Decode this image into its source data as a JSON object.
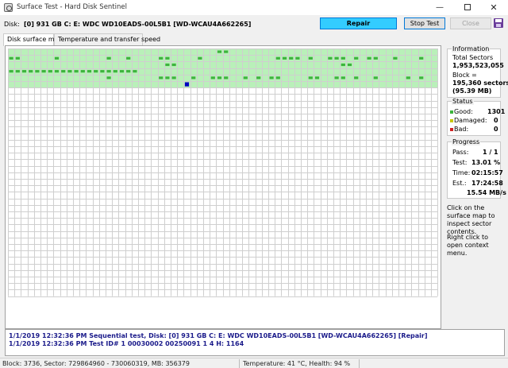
{
  "window": {
    "title": "Surface Test - Hard Disk Sentinel",
    "controls": {
      "minimize": "—",
      "close": "✕"
    }
  },
  "disk": {
    "label": "Disk:",
    "value": "[0] 931 GB C: E: WDC WD10EADS-00L5B1 [WD-WCAU4A662265]"
  },
  "buttons": {
    "repair": "Repair",
    "stop_test": "Stop Test",
    "close": "Close",
    "save_icon": "save-icon"
  },
  "tabs": [
    {
      "label": "Disk surface map",
      "active": true
    },
    {
      "label": "Temperature and transfer speed",
      "active": false
    }
  ],
  "colors": {
    "processed": "#b9f0b9",
    "good_marker": "#3cb43c",
    "current_block": "#0000c0",
    "grid_line": "#cfcfcf",
    "repair_button": "#33ccff"
  },
  "surface_map": {
    "columns": 66,
    "rows": 38,
    "processed_rows": 6,
    "current_block": {
      "row": 5,
      "col": 27
    },
    "good_markers": [
      {
        "row": 0,
        "col": 32
      },
      {
        "row": 0,
        "col": 33
      },
      {
        "row": 1,
        "col": 0
      },
      {
        "row": 1,
        "col": 1
      },
      {
        "row": 1,
        "col": 7
      },
      {
        "row": 1,
        "col": 15
      },
      {
        "row": 1,
        "col": 18
      },
      {
        "row": 1,
        "col": 23
      },
      {
        "row": 1,
        "col": 24
      },
      {
        "row": 1,
        "col": 29
      },
      {
        "row": 1,
        "col": 41
      },
      {
        "row": 1,
        "col": 42
      },
      {
        "row": 1,
        "col": 43
      },
      {
        "row": 1,
        "col": 44
      },
      {
        "row": 1,
        "col": 46
      },
      {
        "row": 1,
        "col": 49
      },
      {
        "row": 1,
        "col": 50
      },
      {
        "row": 1,
        "col": 51
      },
      {
        "row": 1,
        "col": 53
      },
      {
        "row": 1,
        "col": 55
      },
      {
        "row": 1,
        "col": 56
      },
      {
        "row": 1,
        "col": 59
      },
      {
        "row": 1,
        "col": 63
      },
      {
        "row": 2,
        "col": 24
      },
      {
        "row": 2,
        "col": 25
      },
      {
        "row": 2,
        "col": 51
      },
      {
        "row": 2,
        "col": 52
      },
      {
        "row": 3,
        "col": 0
      },
      {
        "row": 3,
        "col": 1
      },
      {
        "row": 3,
        "col": 2
      },
      {
        "row": 3,
        "col": 3
      },
      {
        "row": 3,
        "col": 4
      },
      {
        "row": 3,
        "col": 5
      },
      {
        "row": 3,
        "col": 6
      },
      {
        "row": 3,
        "col": 7
      },
      {
        "row": 3,
        "col": 8
      },
      {
        "row": 3,
        "col": 9
      },
      {
        "row": 3,
        "col": 10
      },
      {
        "row": 3,
        "col": 11
      },
      {
        "row": 3,
        "col": 12
      },
      {
        "row": 3,
        "col": 13
      },
      {
        "row": 3,
        "col": 14
      },
      {
        "row": 3,
        "col": 15
      },
      {
        "row": 3,
        "col": 16
      },
      {
        "row": 3,
        "col": 17
      },
      {
        "row": 3,
        "col": 18
      },
      {
        "row": 3,
        "col": 19
      },
      {
        "row": 4,
        "col": 15
      },
      {
        "row": 4,
        "col": 23
      },
      {
        "row": 4,
        "col": 24
      },
      {
        "row": 4,
        "col": 25
      },
      {
        "row": 4,
        "col": 28
      },
      {
        "row": 4,
        "col": 31
      },
      {
        "row": 4,
        "col": 32
      },
      {
        "row": 4,
        "col": 33
      },
      {
        "row": 4,
        "col": 36
      },
      {
        "row": 4,
        "col": 38
      },
      {
        "row": 4,
        "col": 40
      },
      {
        "row": 4,
        "col": 41
      },
      {
        "row": 4,
        "col": 46
      },
      {
        "row": 4,
        "col": 47
      },
      {
        "row": 4,
        "col": 50
      },
      {
        "row": 4,
        "col": 51
      },
      {
        "row": 4,
        "col": 53
      },
      {
        "row": 4,
        "col": 56
      },
      {
        "row": 4,
        "col": 61
      },
      {
        "row": 4,
        "col": 63
      }
    ]
  },
  "information": {
    "title": "Information",
    "total_sectors_label": "Total Sectors",
    "total_sectors": "1,953,523,055",
    "block_label": "Block =",
    "block_sectors": "195,360 sectors",
    "block_size": "(95.39 MB)"
  },
  "status": {
    "title": "Status",
    "good_label": "Good:",
    "good": "1301",
    "damaged_label": "Damaged:",
    "damaged": "0",
    "bad_label": "Bad:",
    "bad": "0",
    "good_color": "#3cb43c",
    "damaged_color": "#c8c800",
    "bad_color": "#d02020"
  },
  "progress": {
    "title": "Progress",
    "pass_label": "Pass:",
    "pass": "1 / 1",
    "test_label": "Test:",
    "test": "13.01 %",
    "time_label": "Time:",
    "time": "02:15:57",
    "est_label": "Est.:",
    "est": "17:24:58",
    "speed": "15.54 MB/s"
  },
  "hints": {
    "inspect": "Click on the surface map to inspect sector contents.",
    "context": "Right click to open context menu."
  },
  "log": [
    "1/1/2019   12:32:36 PM   Sequential test, Disk: [0] 931 GB C: E: WDC WD10EADS-00L5B1 [WD-WCAU4A662265] [Repair]",
    "1/1/2019   12:32:36 PM   Test ID# 1 00030002 00250091 1 4 H: 1164"
  ],
  "statusbar": {
    "block": "Block: 3736, Sector: 729864960 - 730060319, MB: 356379",
    "temperature": "Temperature: 41  °C,  Health: 94 %"
  }
}
